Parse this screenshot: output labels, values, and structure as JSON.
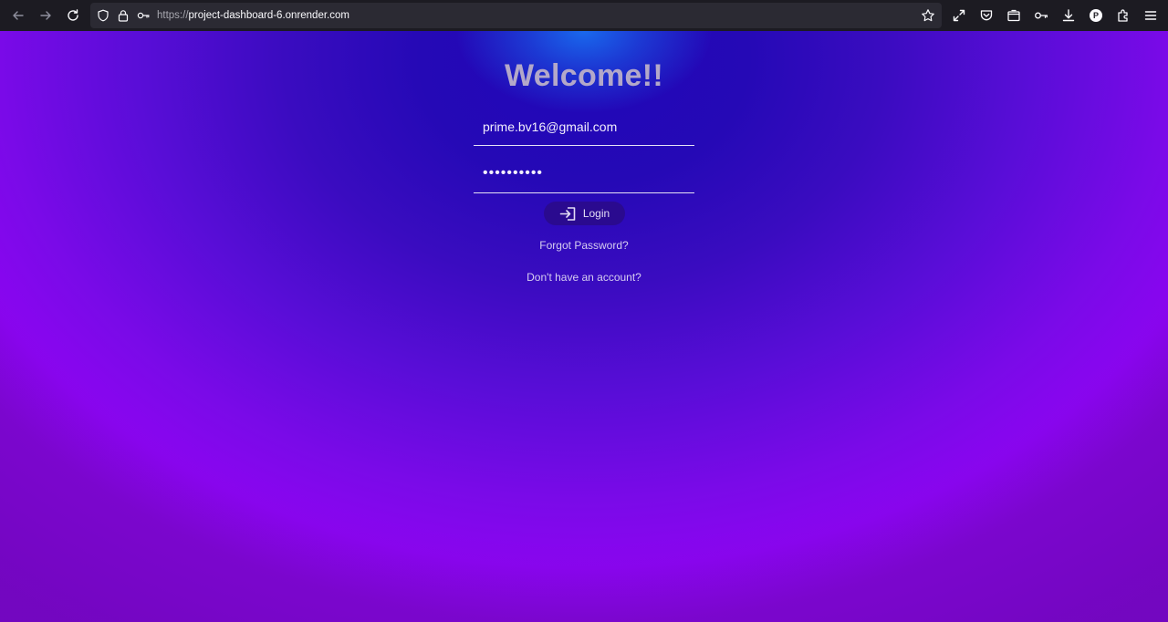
{
  "browser": {
    "url_scheme": "https://",
    "url_host": "project-dashboard-6.onrender.com",
    "profile_initial": "P",
    "icons": {
      "back": "arrow-left-icon",
      "forward": "arrow-right-icon",
      "reload": "reload-icon",
      "tracking_shield": "shield-icon",
      "lock": "lock-icon",
      "permissions": "key-icon",
      "bookmark": "star-icon",
      "fullscreen": "expand-icon",
      "pocket": "pocket-icon",
      "containers": "container-icon",
      "passwords": "key-icon",
      "downloads": "download-icon",
      "account": "profile-icon",
      "extensions": "puzzle-icon",
      "menu": "hamburger-menu-icon"
    }
  },
  "page": {
    "title": "Welcome!!",
    "email_value": "prime.bv16@gmail.com",
    "password_value": "••••••••••",
    "login_label": "Login",
    "forgot_label": "Forgot Password?",
    "signup_label": "Don't have an account?"
  },
  "colors": {
    "gradient_center": "#2007b8",
    "gradient_edge": "#8a05f0",
    "glow": "#196ef0",
    "button_bg": "#2a0a8f",
    "title_color": "#b3a8c9"
  }
}
